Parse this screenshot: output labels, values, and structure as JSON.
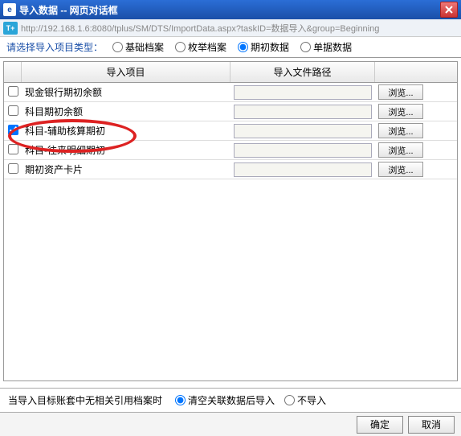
{
  "window": {
    "title": "导入数据 -- 网页对话框",
    "url": "http://192.168.1.6:8080/tplus/SM/DTS/ImportData.aspx?taskID=数据导入&group=Beginning",
    "tplus_badge": "T+"
  },
  "type_selector": {
    "label": "请选择导入项目类型：",
    "options": [
      {
        "label": "基础档案",
        "checked": false
      },
      {
        "label": "枚举档案",
        "checked": false
      },
      {
        "label": "期初数据",
        "checked": true
      },
      {
        "label": "单据数据",
        "checked": false
      }
    ]
  },
  "table": {
    "headers": {
      "item": "导入项目",
      "path": "导入文件路径"
    },
    "browse_label": "浏览...",
    "rows": [
      {
        "checked": false,
        "label": "现金银行期初余额"
      },
      {
        "checked": false,
        "label": "科目期初余额"
      },
      {
        "checked": true,
        "label": "科目-辅助核算期初"
      },
      {
        "checked": false,
        "label": "科目-往来明细期初"
      },
      {
        "checked": false,
        "label": "期初资产卡片"
      }
    ]
  },
  "footer": {
    "prompt": "当导入目标账套中无相关引用档案时",
    "options": [
      {
        "label": "清空关联数据后导入",
        "checked": true
      },
      {
        "label": "不导入",
        "checked": false
      }
    ],
    "ok": "确定",
    "cancel": "取消"
  }
}
